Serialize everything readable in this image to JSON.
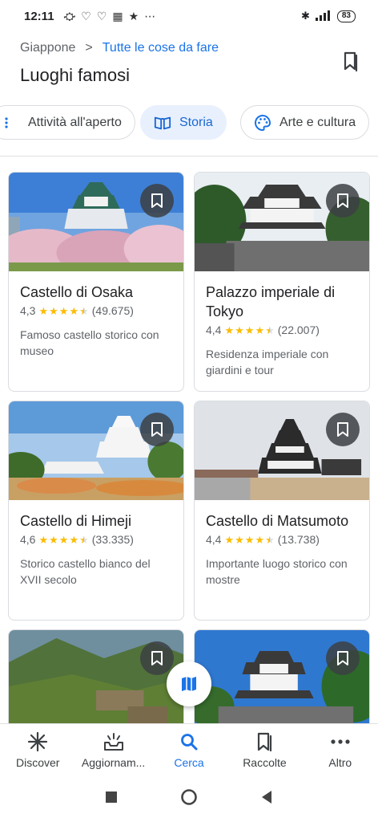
{
  "status_bar": {
    "time": "12:11",
    "battery": "83"
  },
  "header": {
    "breadcrumb_parent": "Giappone",
    "breadcrumb_separator": ">",
    "breadcrumb_current": "Tutte le cose da fare",
    "title": "Luoghi famosi"
  },
  "chips": [
    {
      "label": "Attività all'aperto",
      "icon": "outdoor-icon",
      "active": false
    },
    {
      "label": "Storia",
      "icon": "history-book-icon",
      "active": true
    },
    {
      "label": "Arte e cultura",
      "icon": "palette-icon",
      "active": false
    }
  ],
  "places": [
    {
      "name": "Castello di Osaka",
      "rating": "4,3",
      "rating_value": 4.3,
      "reviews": "(49.675)",
      "description": "Famoso castello storico con museo"
    },
    {
      "name": "Palazzo imperiale di Tokyo",
      "rating": "4,4",
      "rating_value": 4.4,
      "reviews": "(22.007)",
      "description": "Residenza imperiale con giardini e tour"
    },
    {
      "name": "Castello di Himeji",
      "rating": "4,6",
      "rating_value": 4.6,
      "reviews": "(33.335)",
      "description": "Storico castello bianco del XVII secolo"
    },
    {
      "name": "Castello di Matsumoto",
      "rating": "4,4",
      "rating_value": 4.4,
      "reviews": "(13.738)",
      "description": "Importante luogo storico con mostre"
    },
    {
      "name": "",
      "rating": "",
      "reviews": "",
      "description": ""
    },
    {
      "name": "",
      "rating": "",
      "reviews": "",
      "description": ""
    }
  ],
  "bottom_nav": [
    {
      "label": "Discover",
      "icon": "sparkle-icon",
      "active": false
    },
    {
      "label": "Aggiornam...",
      "icon": "updates-icon",
      "active": false
    },
    {
      "label": "Cerca",
      "icon": "search-icon",
      "active": true
    },
    {
      "label": "Raccolte",
      "icon": "collections-icon",
      "active": false
    },
    {
      "label": "Altro",
      "icon": "more-icon",
      "active": false
    }
  ],
  "colors": {
    "accent": "#1a73e8",
    "chip_active_bg": "#e8f0fe",
    "star": "#fbbc04",
    "text_secondary": "#5f6368"
  }
}
